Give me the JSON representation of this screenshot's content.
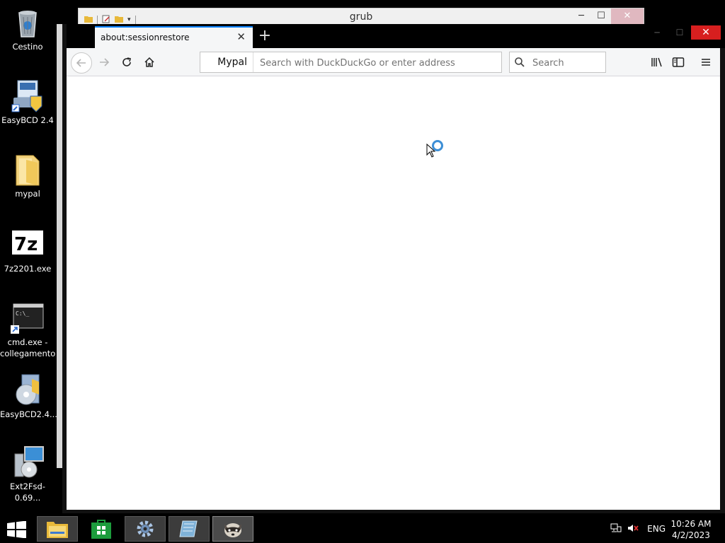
{
  "desktop": {
    "icons": [
      {
        "name": "recycle-bin",
        "label": "Cestino"
      },
      {
        "name": "easybcd",
        "label": "EasyBCD 2.4"
      },
      {
        "name": "mypal-folder",
        "label": "mypal"
      },
      {
        "name": "7zip-installer",
        "label": "7z2201.exe"
      },
      {
        "name": "cmd-shortcut",
        "label": "cmd.exe - collegamento"
      },
      {
        "name": "easybcd-installer",
        "label": "EasyBCD2.4..."
      },
      {
        "name": "ext2fsd-installer",
        "label": "Ext2Fsd-0.69..."
      }
    ]
  },
  "background_window": {
    "title": "grub"
  },
  "browser": {
    "tab_title": "about:sessionrestore",
    "identity_label": "Mypal",
    "url_placeholder": "Search with DuckDuckGo or enter address",
    "search_placeholder": "Search"
  },
  "taskbar": {
    "language": "ENG",
    "time": "10:26 AM",
    "date": "4/2/2023"
  },
  "colors": {
    "tab_accent": "#0a84ff",
    "close_red": "#d71f1f",
    "spinner_blue": "#3d8fd6"
  }
}
